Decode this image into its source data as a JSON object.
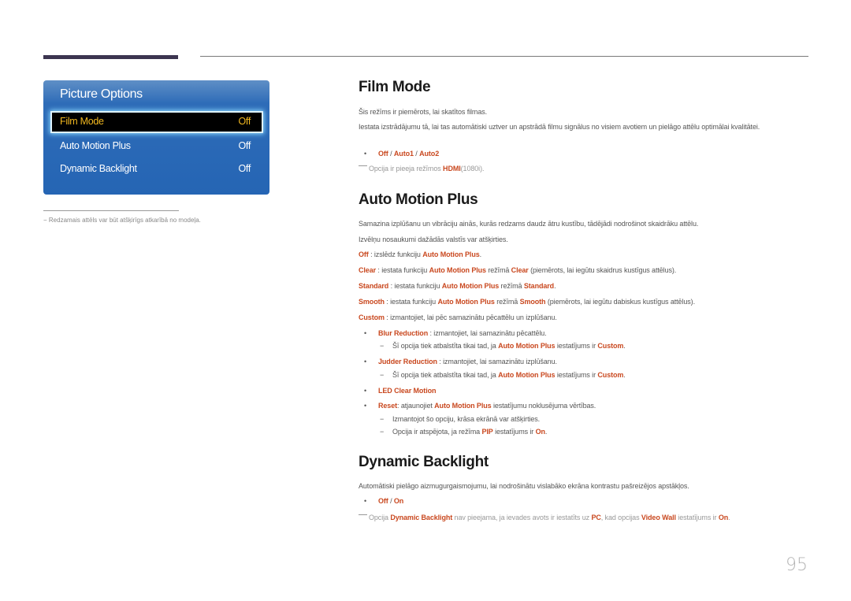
{
  "osd": {
    "title": "Picture Options",
    "items": [
      {
        "label": "Film Mode",
        "value": "Off",
        "selected": true
      },
      {
        "label": "Auto Motion Plus",
        "value": "Off",
        "selected": false
      },
      {
        "label": "Dynamic Backlight",
        "value": "Off",
        "selected": false
      }
    ]
  },
  "left_note": "−  Redzamais attēls var būt atšķirīgs atkarībā no modeļa.",
  "film_mode": {
    "heading": "Film Mode",
    "p1": "Šis režīms ir piemērots, lai skatītos filmas.",
    "p2": "Iestata izstrādājumu tā, lai tas automātiski uztver un apstrādā filmu signālus no visiem avotiem un pielāgo attēlu optimālai kvalitātei.",
    "options": [
      "Off",
      "Auto1",
      "Auto2"
    ],
    "note_pre": "Opcija ir pieeja režīmos ",
    "note_hl": "HDMI",
    "note_post": "(1080i)."
  },
  "amp": {
    "heading": "Auto Motion Plus",
    "p1": "Samazina izplūšanu un vibrāciju ainās, kurās redzams daudz ātru kustību, tādējādi nodrošinot skaidrāku attēlu.",
    "p2": "Izvēlņu nosaukumi dažādās valstīs var atšķirties.",
    "off": {
      "k": "Off",
      "t1": " : izslēdz funkciju ",
      "h1": "Auto Motion Plus",
      "t2": "."
    },
    "clear": {
      "k": "Clear",
      "t1": " : iestata funkciju ",
      "h1": "Auto Motion Plus",
      "t2": " režīmā ",
      "h2": "Clear",
      "t3": " (piemērots, lai iegūtu skaidrus kustīgus attēlus)."
    },
    "standard": {
      "k": "Standard",
      "t1": " : iestata funkciju ",
      "h1": "Auto Motion Plus",
      "t2": " režīmā ",
      "h2": "Standard",
      "t3": "."
    },
    "smooth": {
      "k": "Smooth",
      "t1": " : iestata funkciju ",
      "h1": "Auto Motion Plus",
      "t2": " režīmā ",
      "h2": "Smooth",
      "t3": " (piemērots, lai iegūtu dabiskus kustīgus attēlus)."
    },
    "custom": {
      "k": "Custom",
      "t1": " : izmantojiet, lai pēc samazinātu pēcattēlu un izplūšanu."
    },
    "blur": {
      "k": "Blur Reduction",
      "t1": "  : izmantojiet, lai samazinātu pēcattēlu."
    },
    "blur_sub": {
      "t1": "Šī opcija tiek atbalstīta tikai tad, ja ",
      "h1": "Auto Motion Plus",
      "t2": " iestatījums ir ",
      "h2": "Custom",
      "t3": "."
    },
    "judder": {
      "k": "Judder Reduction",
      "t1": " : izmantojiet, lai samazinātu izplūšanu."
    },
    "judder_sub": {
      "t1": "Šī opcija tiek atbalstīta tikai tad, ja ",
      "h1": "Auto Motion Plus",
      "t2": " iestatījums ir ",
      "h2": "Custom",
      "t3": "."
    },
    "led": "LED Clear Motion",
    "reset": {
      "k": "Reset",
      "t1": ": atjaunojiet ",
      "h1": "Auto Motion Plus",
      "t2": " iestatījumu noklusējuma vērtības."
    },
    "reset_sub1": "Izmantojot šo opciju, krāsa ekrānā var atšķirties.",
    "reset_sub2": {
      "t1": "Opcija ir atspējota, ja režīma ",
      "h1": "PIP",
      "t2": " iestatījums ir ",
      "h2": "On",
      "t3": "."
    }
  },
  "db": {
    "heading": "Dynamic Backlight",
    "p1": "Automātiski pielāgo aizmugurgaismojumu, lai nodrošinātu vislabāko ekrāna kontrastu pašreizējos apstākļos.",
    "options": [
      "Off",
      "On"
    ],
    "note": {
      "t1": "Opcija ",
      "h1": "Dynamic Backlight",
      "t2": " nav pieejama, ja ievades avots ir iestatīts uz ",
      "h2": "PC",
      "t3": ", kad opcijas ",
      "h3": "Video Wall",
      "t4": " iestatījums ir ",
      "h4": "On",
      "t5": "."
    }
  },
  "page_number": "95"
}
